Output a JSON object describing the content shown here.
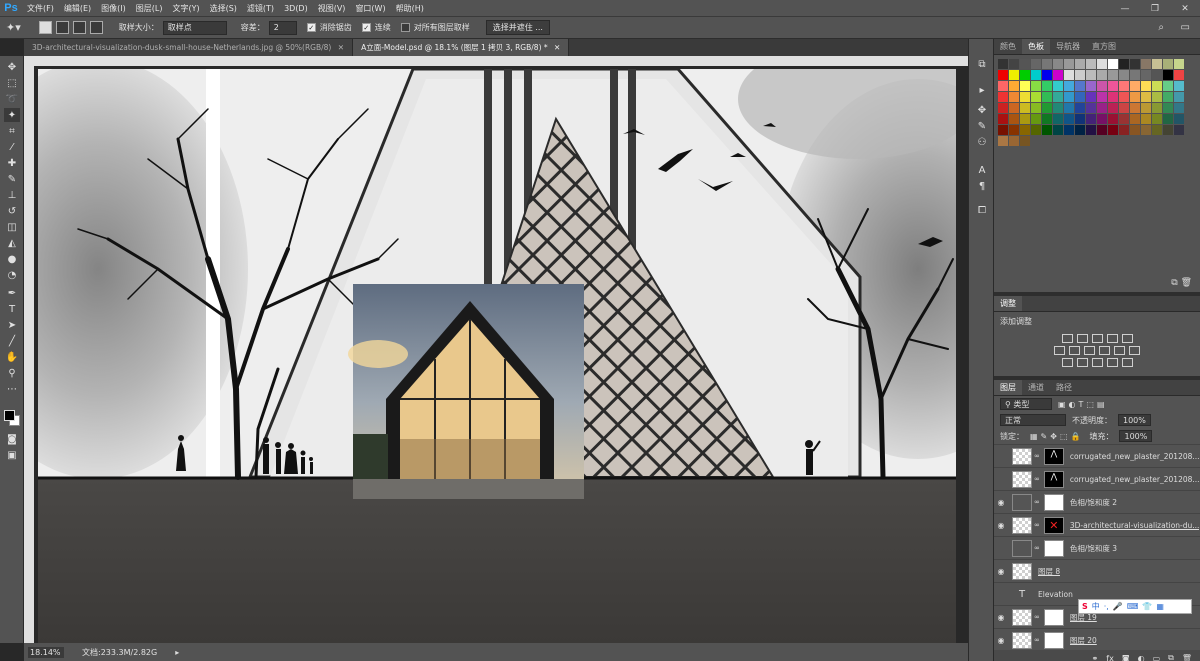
{
  "app": {
    "logo": "Ps"
  },
  "menu": [
    "文件(F)",
    "编辑(E)",
    "图像(I)",
    "图层(L)",
    "文字(Y)",
    "选择(S)",
    "滤镜(T)",
    "3D(D)",
    "视图(V)",
    "窗口(W)",
    "帮助(H)"
  ],
  "window_controls": {
    "minimize": "—",
    "maximize": "❐",
    "close": "✕"
  },
  "options": {
    "sample_size_label": "取样大小：",
    "sample_size_value": "取样点",
    "tolerance_label": "容差：",
    "tolerance_value": "2",
    "antialias_label": "消除锯齿",
    "contiguous_label": "连续",
    "sample_all_label": "对所有图层取样",
    "select_mask_button": "选择并遮住 ..."
  },
  "tabs": [
    {
      "label": "3D-architectural-visualization-dusk-small-house-Netherlands.jpg @ 50%(RGB/8)",
      "close": "✕"
    },
    {
      "label": "A立面-Model.psd @ 18.1% (图层 1 拷贝 3, RGB/8) *",
      "close": "✕"
    }
  ],
  "status": {
    "zoom": "18.14%",
    "doc": "文档:233.3M/2.82G"
  },
  "panels": {
    "color_tabs": [
      "颜色",
      "色板",
      "导航器",
      "直方图"
    ],
    "adjust_tab": "调整",
    "adjust_title": "添加调整",
    "layers_tabs": [
      "图层",
      "通道",
      "路径"
    ],
    "kind_label": "类型",
    "blend_mode": "正常",
    "opacity_label": "不透明度：",
    "opacity_value": "100%",
    "lock_label": "锁定：",
    "fill_label": "填充：",
    "fill_value": "100%"
  },
  "layers": [
    {
      "name": "corrugated_new_plaster_201208...",
      "visible": false,
      "thumb": "checker",
      "mask": "black-mark"
    },
    {
      "name": "corrugated_new_plaster_201208...",
      "visible": false,
      "thumb": "checker",
      "mask": "black-mark"
    },
    {
      "name": "色相/饱和度 2",
      "visible": true,
      "thumb": "adj",
      "mask": "white"
    },
    {
      "name": "3D-architectural-visualization-du...",
      "visible": true,
      "thumb": "checker",
      "mask": "red-x"
    },
    {
      "name": "色相/饱和度 3",
      "visible": false,
      "thumb": "adj",
      "mask": "white"
    },
    {
      "name": "图层 8",
      "visible": true,
      "thumb": "checker",
      "mask": ""
    },
    {
      "name": "Elevation",
      "visible": false,
      "thumb": "text",
      "mask": ""
    },
    {
      "name": "图层 19",
      "visible": true,
      "thumb": "checker",
      "mask": "white"
    },
    {
      "name": "图层 20",
      "visible": true,
      "thumb": "checker",
      "mask": "white"
    }
  ],
  "ime": {
    "logo": "S",
    "lang": "中"
  },
  "colors": {
    "accent": "#31a8ff",
    "panel": "#535353",
    "dark": "#282828"
  }
}
